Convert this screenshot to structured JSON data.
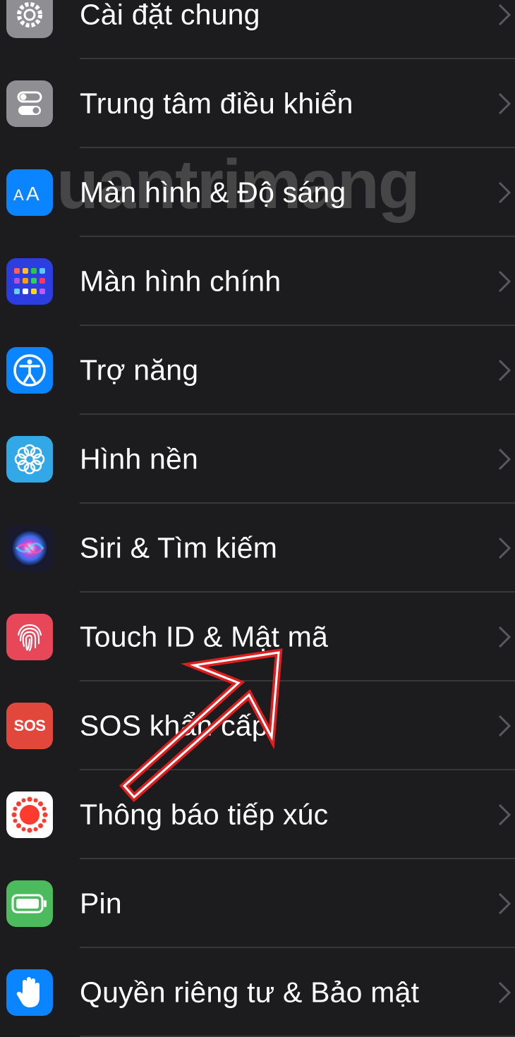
{
  "watermark": "uantrimang",
  "settings": {
    "items": [
      {
        "label": "Cài đặt chung",
        "icon": "gear-icon",
        "color": "#8e8e93"
      },
      {
        "label": "Trung tâm điều khiển",
        "icon": "toggles-icon",
        "color": "#8e8e93"
      },
      {
        "label": "Màn hình & Độ sáng",
        "icon": "text-size-icon",
        "color": "#0a84ff"
      },
      {
        "label": "Màn hình chính",
        "icon": "app-grid-icon",
        "color": "#2c3ee0"
      },
      {
        "label": "Trợ năng",
        "icon": "accessibility-icon",
        "color": "#0a84ff"
      },
      {
        "label": "Hình nền",
        "icon": "wallpaper-flower-icon",
        "color": "#33a8e6"
      },
      {
        "label": "Siri & Tìm kiếm",
        "icon": "siri-icon",
        "color": "#1a1a2e"
      },
      {
        "label": "Touch ID & Mật mã",
        "icon": "fingerprint-icon",
        "color": "#e8475a"
      },
      {
        "label": "SOS khẩn cấp",
        "icon": "sos-icon",
        "color": "#e2473b",
        "icon_text": "SOS"
      },
      {
        "label": "Thông báo tiếp xúc",
        "icon": "exposure-notification-icon",
        "color": "#ffffff"
      },
      {
        "label": "Pin",
        "icon": "battery-icon",
        "color": "#4cbb5e"
      },
      {
        "label": "Quyền riêng tư & Bảo mật",
        "icon": "hand-icon",
        "color": "#0a84ff"
      }
    ]
  },
  "colors": {
    "background": "#1c1c1e",
    "separator": "#38383a",
    "chevron": "#5a5a5e",
    "annotation": "#e01e1e"
  }
}
